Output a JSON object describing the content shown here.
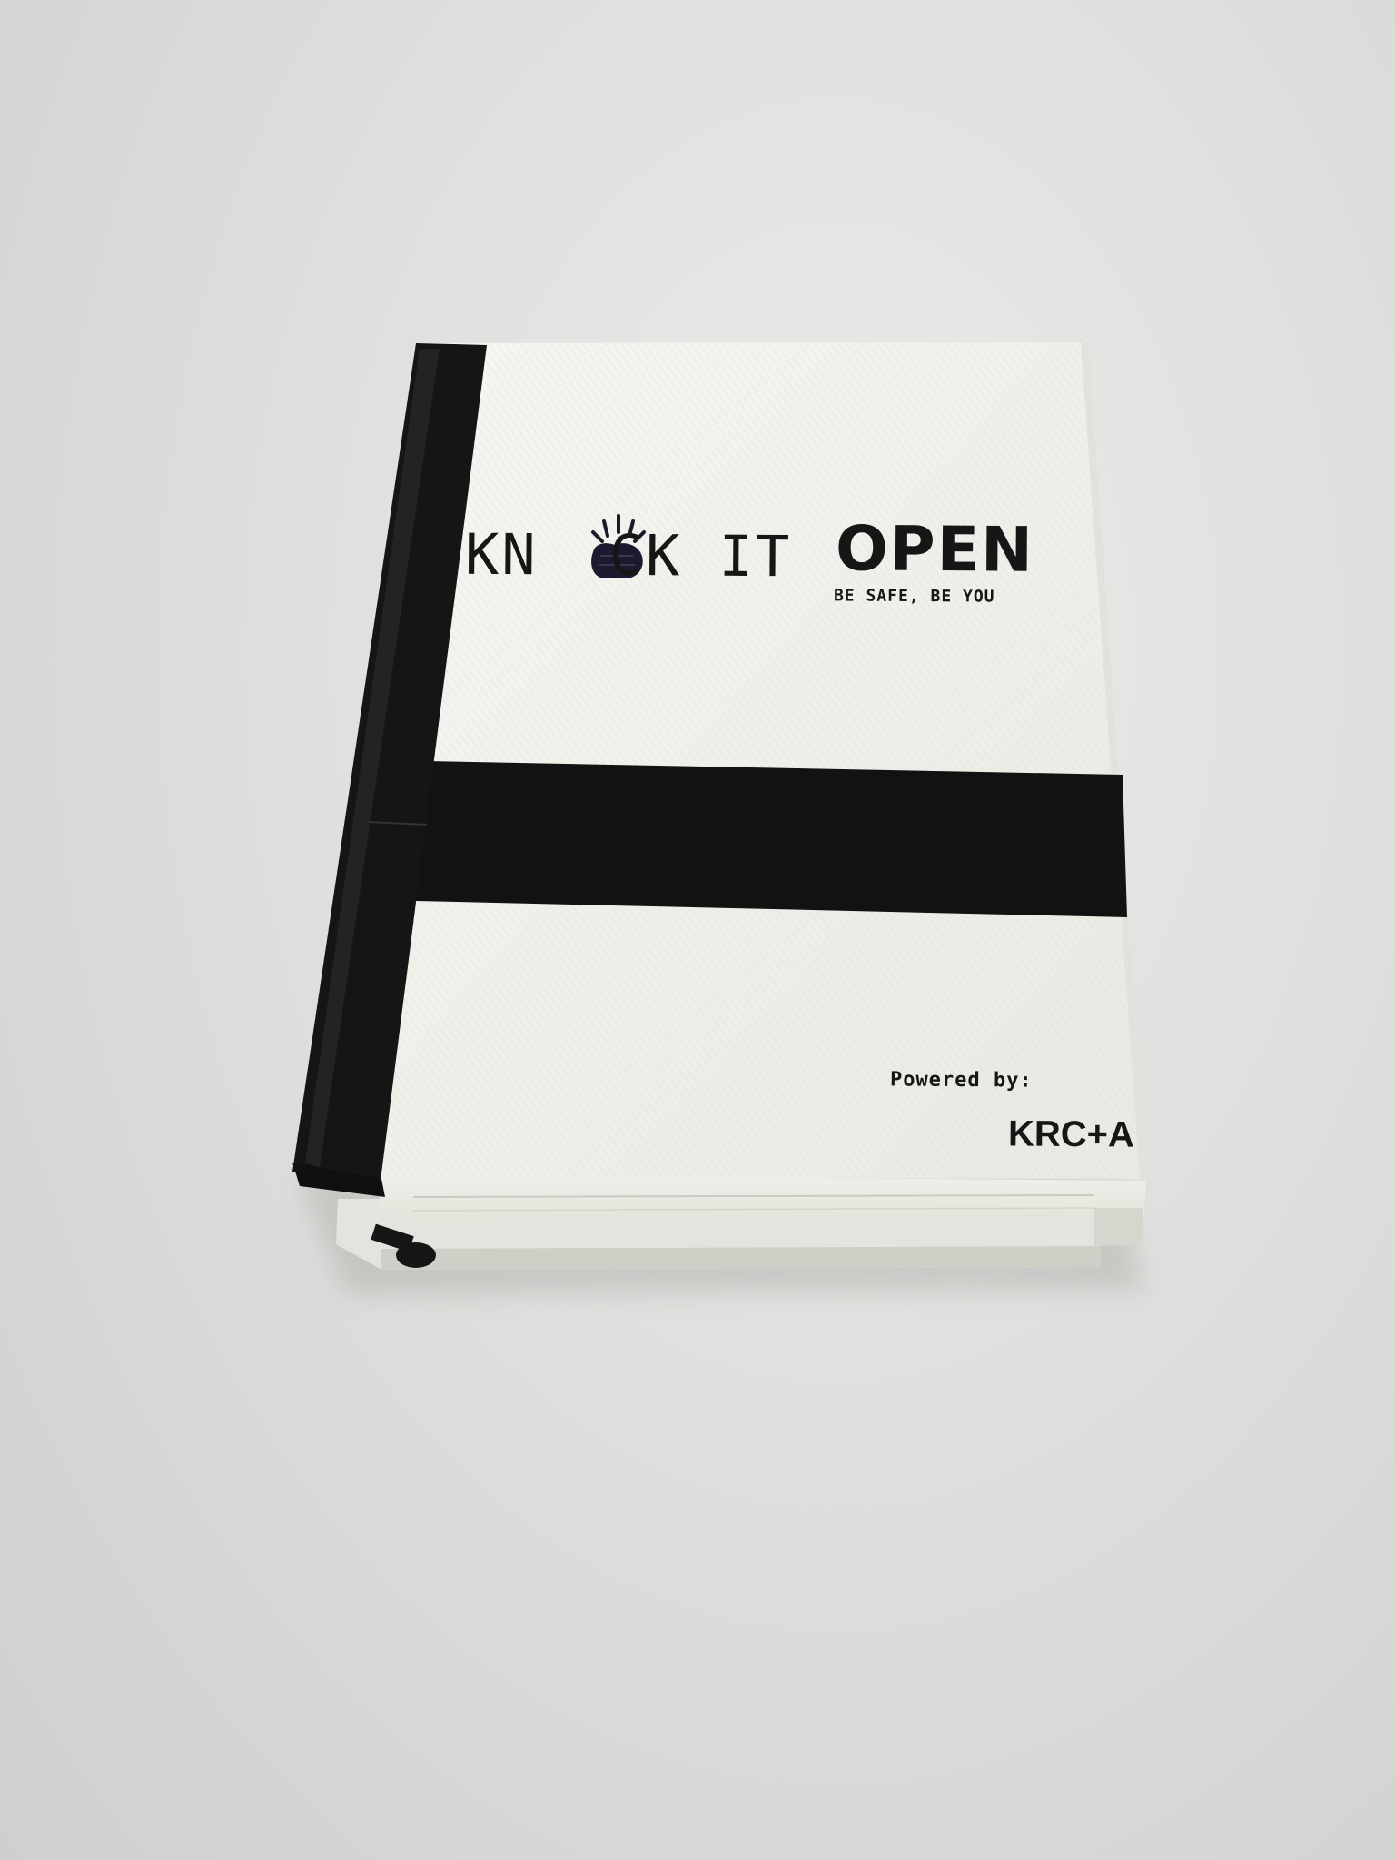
{
  "photo": {
    "subject": "book-shaped 3D printed box",
    "colors": {
      "background": "#d8d8d6",
      "cover": "#f1f1ec",
      "spine": "#141414",
      "pages": "#e8e8e2",
      "ink": "#161616"
    }
  },
  "cover": {
    "title_left": "KN",
    "title_middle": "CK IT",
    "title_bold": "OPEN",
    "knock_icon": "knocking-hand-icon",
    "tagline": "BE SAFE, BE YOU",
    "credit_label": "Powered by:",
    "credit_name": "KRC+A"
  }
}
